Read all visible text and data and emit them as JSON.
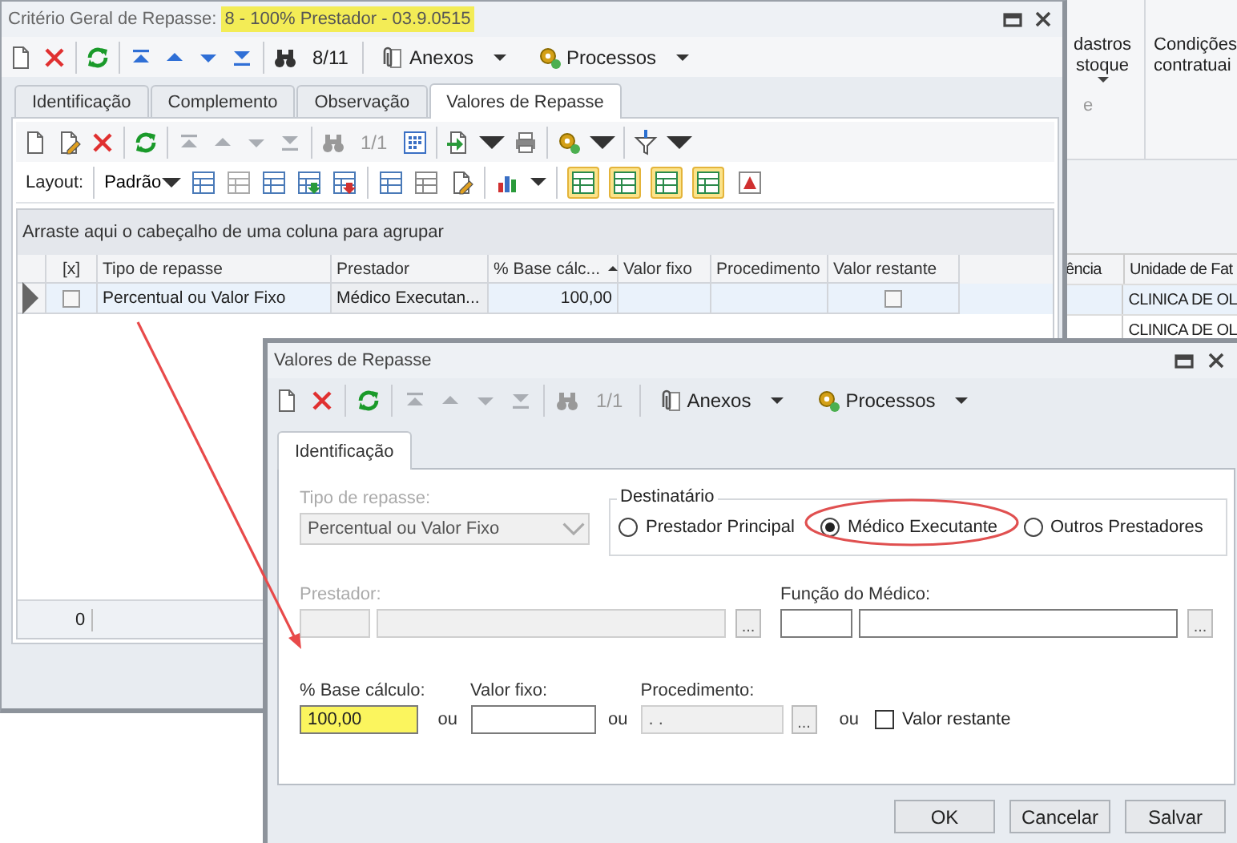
{
  "background_app": {
    "ribbon_buttons": [
      {
        "lines": [
          "dastros",
          "stoque"
        ],
        "has_menu": true
      },
      {
        "lines": [
          "Condições",
          "contratuai"
        ],
        "has_menu": false
      }
    ],
    "ribbon_group_label": "e",
    "grid": {
      "columns": [
        "ência",
        "Unidade de Fat"
      ],
      "rows": [
        {
          "unidade": "CLINICA DE OL"
        },
        {
          "unidade": "CLINICA DE OL"
        }
      ]
    }
  },
  "main_window": {
    "title": "Critério Geral de Repasse:",
    "title_record": "8 - 100% Prestador - 03.9.0515",
    "toolbar": {
      "nav_enabled": true,
      "record_counter": "8/11",
      "menus": [
        "Anexos",
        "Processos"
      ]
    },
    "tabs": [
      {
        "label": "Identificação",
        "selected": false
      },
      {
        "label": "Complemento",
        "selected": false
      },
      {
        "label": "Observação",
        "selected": false
      },
      {
        "label": "Valores de Repasse",
        "selected": true
      }
    ],
    "grid_toolbar": {
      "nav_enabled": false,
      "record_counter": "1/1"
    },
    "layout_bar": {
      "label": "Layout:",
      "preset": "Padrão",
      "view_toggles": [
        {
          "on": true
        },
        {
          "on": true
        },
        {
          "on": true
        },
        {
          "on": true
        },
        {
          "on": false
        }
      ]
    },
    "group_panel": "Arraste aqui o cabeçalho de uma coluna para agrupar",
    "grid": {
      "columns": [
        {
          "label": "[x]"
        },
        {
          "label": "Tipo de repasse"
        },
        {
          "label": "Prestador"
        },
        {
          "label": "% Base cálc...",
          "sorted_ascending": true
        },
        {
          "label": "Valor fixo"
        },
        {
          "label": "Procedimento"
        },
        {
          "label": "Valor restante"
        }
      ],
      "rows": [
        {
          "selected": true,
          "checked": false,
          "tipo": "Percentual ou Valor Fixo",
          "prestador": "Médico Executan...",
          "base": "100,00",
          "valor_restante": false
        }
      ]
    },
    "footer_count": "0"
  },
  "dialog": {
    "title": "Valores de Repasse",
    "toolbar": {
      "nav_enabled": false,
      "record_counter": "1/1",
      "menus": [
        "Anexos",
        "Processos"
      ]
    },
    "tabs": [
      {
        "label": "Identificação",
        "selected": true
      }
    ],
    "tipo_repasse": {
      "label": "Tipo de repasse:",
      "value": "Percentual ou Valor Fixo",
      "disabled": true
    },
    "destinatario": {
      "label": "Destinatário",
      "options": [
        {
          "label": "Prestador Principal",
          "selected": false
        },
        {
          "label": "Médico Executante",
          "selected": true
        },
        {
          "label": "Outros Prestadores",
          "selected": false
        }
      ]
    },
    "prestador": {
      "label": "Prestador:",
      "disabled": true,
      "button": "..."
    },
    "funcao_medico": {
      "label": "Função do Médico:",
      "disabled": false,
      "button": "..."
    },
    "base_calculo": {
      "label": "% Base cálculo:",
      "value": "100,00",
      "highlighted": true
    },
    "or_words": [
      "ou",
      "ou",
      "ou"
    ],
    "valor_fixo": {
      "label": "Valor fixo:"
    },
    "procedimento": {
      "label": "Procedimento:",
      "value": ". .",
      "disabled": true,
      "button": "..."
    },
    "valor_restante": {
      "label": "Valor restante",
      "checked": false
    },
    "buttons": [
      "OK",
      "Cancelar",
      "Salvar"
    ]
  }
}
